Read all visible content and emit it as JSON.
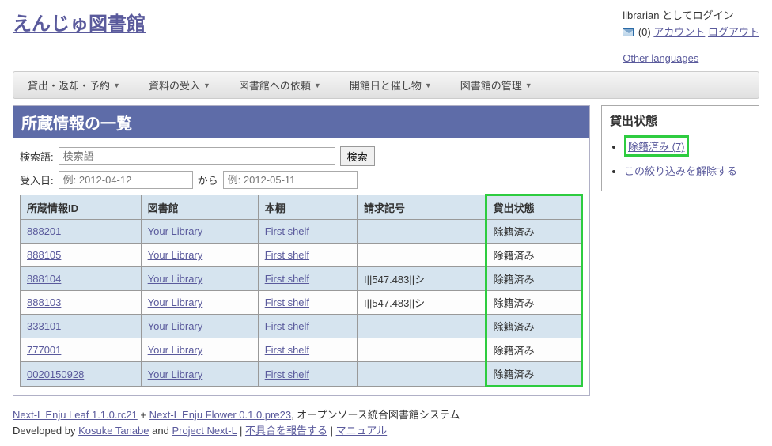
{
  "header": {
    "site_title": "えんじゅ図書館",
    "login_as": "librarian としてログイン",
    "msg_count": "(0)",
    "account": "アカウント",
    "logout": "ログアウト",
    "other_lang": "Other languages"
  },
  "menu": {
    "items": [
      "貸出・返却・予約",
      "資料の受入",
      "図書館への依頼",
      "開館日と催し物",
      "図書館の管理"
    ]
  },
  "page": {
    "title": "所蔵情報の一覧",
    "search_label": "検索語:",
    "search_placeholder": "検索語",
    "search_btn": "検索",
    "date_label": "受入日:",
    "date_from_placeholder": "例: 2012-04-12",
    "date_to_placeholder": "例: 2012-05-11",
    "date_sep": "から"
  },
  "table": {
    "headers": {
      "id": "所蔵情報ID",
      "library": "図書館",
      "shelf": "本棚",
      "call": "請求記号",
      "status": "貸出状態"
    },
    "rows": [
      {
        "id": "888201",
        "library": "Your Library",
        "shelf": "First shelf",
        "call": "",
        "status": "除籍済み"
      },
      {
        "id": "888105",
        "library": "Your Library",
        "shelf": "First shelf",
        "call": "",
        "status": "除籍済み"
      },
      {
        "id": "888104",
        "library": "Your Library",
        "shelf": "First shelf",
        "call": "I||547.483||シ",
        "status": "除籍済み"
      },
      {
        "id": "888103",
        "library": "Your Library",
        "shelf": "First shelf",
        "call": "I||547.483||シ",
        "status": "除籍済み"
      },
      {
        "id": "333101",
        "library": "Your Library",
        "shelf": "First shelf",
        "call": "",
        "status": "除籍済み"
      },
      {
        "id": "777001",
        "library": "Your Library",
        "shelf": "First shelf",
        "call": "",
        "status": "除籍済み"
      },
      {
        "id": "0020150928",
        "library": "Your Library",
        "shelf": "First shelf",
        "call": "",
        "status": "除籍済み"
      }
    ]
  },
  "sidebar": {
    "title": "貸出状態",
    "filter": "除籍済み (7)",
    "reset": "この絞り込みを解除する"
  },
  "footer": {
    "leaf": "Next-L Enju Leaf 1.1.0.rc21",
    "plus": " + ",
    "flower": "Next-L Enju Flower 0.1.0.pre23",
    "desc": ", オープンソース統合図書館システム",
    "dev_by": "Developed by ",
    "author": "Kosuke Tanabe",
    "and": " and ",
    "project": "Project Next-L",
    "sep": " | ",
    "bug": "不具合を報告する",
    "manual": "マニュアル"
  }
}
